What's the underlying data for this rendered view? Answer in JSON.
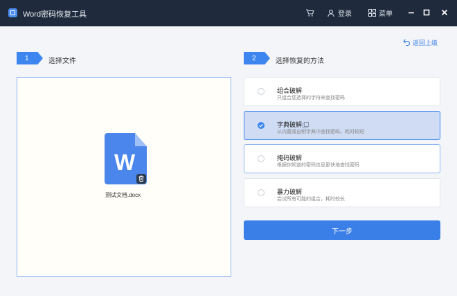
{
  "app": {
    "title": "Word密码恢复工具"
  },
  "toolbar": {
    "cart_icon": "cart-icon",
    "login_label": "登录",
    "menu_label": "菜单"
  },
  "nav": {
    "return_label": "返回上级"
  },
  "step1": {
    "number": "1",
    "label": "选择文件"
  },
  "step2": {
    "number": "2",
    "label": "选择恢复的方法"
  },
  "file": {
    "letter": "W",
    "name": "测试文档.docx"
  },
  "methods": [
    {
      "title": "组合破解",
      "desc": "只组合您选择的字符来查找密码",
      "selected": false
    },
    {
      "title": "字典破解",
      "desc": "从内置或自制字典中查找密码，耗时较短",
      "selected": true
    },
    {
      "title": "掩码破解",
      "desc": "根据你知道的密码信息更快地查找密码",
      "selected": false
    },
    {
      "title": "暴力破解",
      "desc": "尝试所有可能的组合，耗时较长",
      "selected": false
    }
  ],
  "actions": {
    "next_label": "下一步"
  },
  "colors": {
    "accent": "#3d86ef",
    "titlebar": "#1f2b3c",
    "selected_bg": "#cfdcf4"
  }
}
